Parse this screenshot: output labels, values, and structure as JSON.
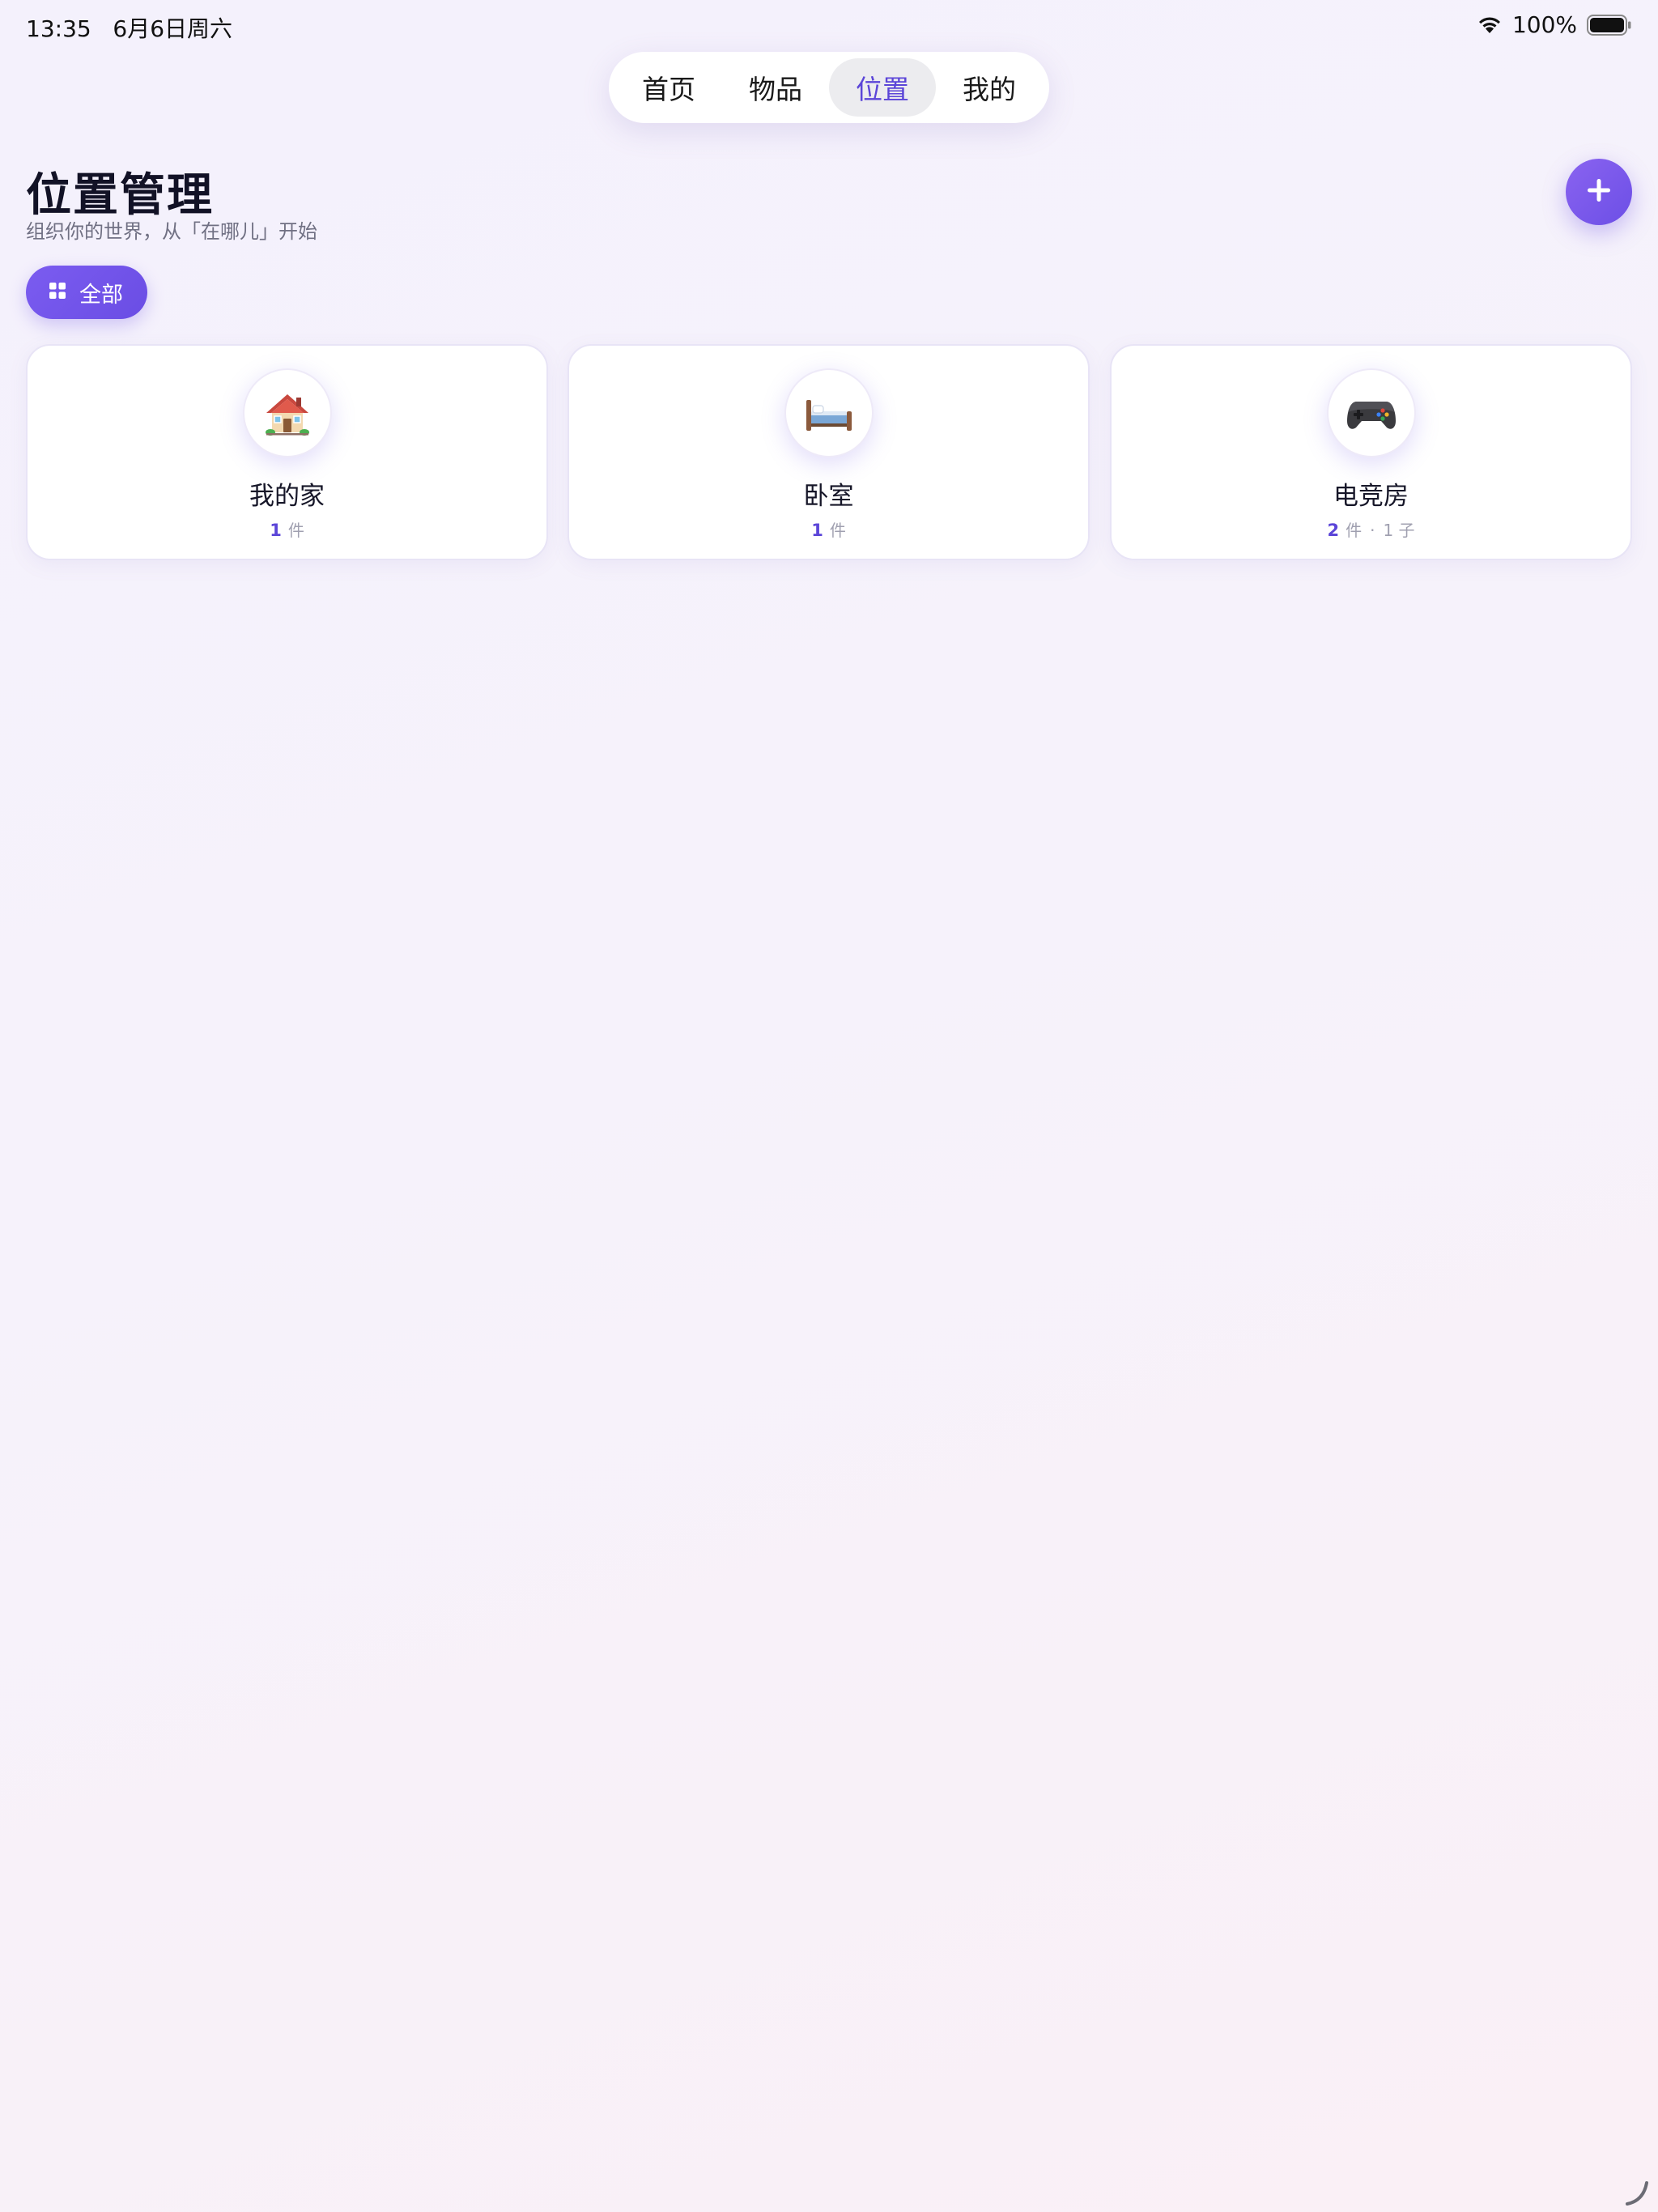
{
  "status_bar": {
    "time": "13:35",
    "date": "6月6日周六",
    "battery": "100%"
  },
  "nav": {
    "tabs": [
      {
        "label": "首页"
      },
      {
        "label": "物品"
      },
      {
        "label": "位置"
      },
      {
        "label": "我的"
      }
    ],
    "active_index": 2
  },
  "header": {
    "title": "位置管理",
    "subtitle": "组织你的世界，从「在哪儿」开始"
  },
  "filter": {
    "label": "全部"
  },
  "locations": [
    {
      "name": "我的家",
      "count": "1",
      "unit": "件",
      "icon": "house-icon"
    },
    {
      "name": "卧室",
      "count": "1",
      "unit": "件",
      "icon": "bed-icon"
    },
    {
      "name": "电竞房",
      "count": "2",
      "unit": "件",
      "sub": "1 子",
      "icon": "gamepad-icon"
    }
  ],
  "colors": {
    "accent": "#6c4fe6",
    "active_tab_text": "#5b45d8",
    "background": "#f5f1fb"
  }
}
